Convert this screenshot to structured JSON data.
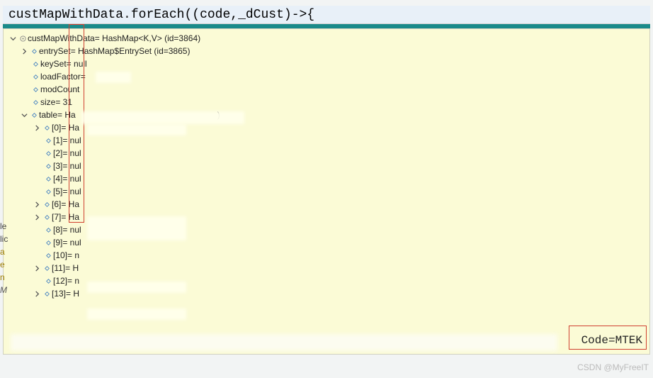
{
  "code_line": {
    "pre": "custMapWithData",
    "dot": ".",
    "method": "forEach",
    "rest": "((code,_dCust)->{"
  },
  "root": {
    "label": "custMapWithData= HashMap<K,V>  (id=3864)"
  },
  "entrySet": {
    "label": "entrySet= HashMap$EntrySet  (id=3865)"
  },
  "keySet": {
    "label": "keySet= null"
  },
  "loadFactor": {
    "label": "loadFactor="
  },
  "modCount": {
    "label": "modCount"
  },
  "size": {
    "label": "size= 31"
  },
  "table": {
    "label": "table= Ha",
    "suffix": ")"
  },
  "rows": [
    {
      "idx": "[0]",
      "val": "Ha",
      "expandable": true
    },
    {
      "idx": "[1]",
      "val": "nul",
      "expandable": false
    },
    {
      "idx": "[2]",
      "val": "nul",
      "expandable": false
    },
    {
      "idx": "[3]",
      "val": "nul",
      "expandable": false
    },
    {
      "idx": "[4]",
      "val": "nul",
      "expandable": false
    },
    {
      "idx": "[5]",
      "val": "nul",
      "expandable": false
    },
    {
      "idx": "[6]",
      "val": "Ha",
      "expandable": true
    },
    {
      "idx": "[7]",
      "val": "Ha",
      "expandable": true
    },
    {
      "idx": "[8]",
      "val": "nul",
      "expandable": false
    },
    {
      "idx": "[9]",
      "val": "nul",
      "expandable": false
    },
    {
      "idx": "[10]",
      "val": "n",
      "expandable": false
    },
    {
      "idx": "[11]",
      "val": "H",
      "expandable": true
    },
    {
      "idx": "[12]",
      "val": "n",
      "expandable": false
    },
    {
      "idx": "[13]",
      "val": "H",
      "expandable": true
    }
  ],
  "bottom_code": "Code=MTEK",
  "watermark": "CSDN @MyFreeIT",
  "left_trunc": {
    "l1": "le",
    "l2": "lic",
    "l3": "a",
    "l4": "e",
    "l5": "n",
    "l6": "M"
  }
}
